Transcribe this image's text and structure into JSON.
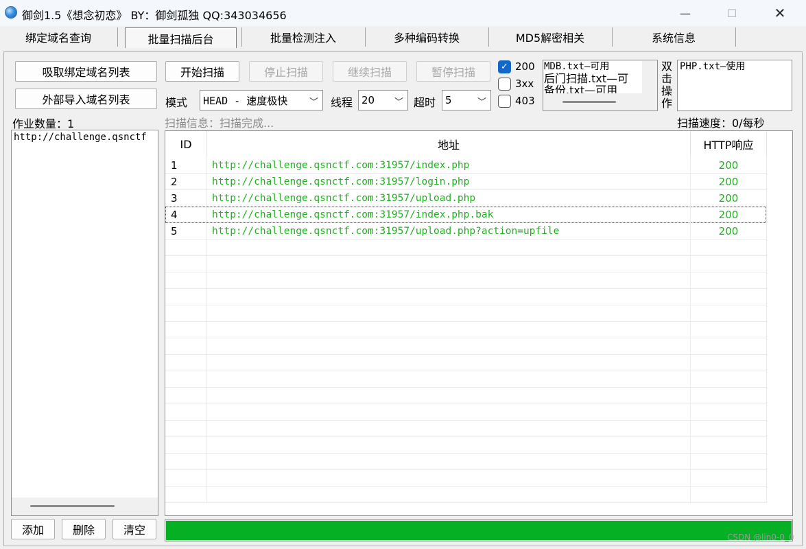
{
  "window": {
    "title": "御剑1.5《想念初恋》 BY：御剑孤独 QQ:343034656",
    "minimize": "—",
    "maximize": "☐",
    "close": "✕"
  },
  "tabs": [
    {
      "label": "绑定域名查询"
    },
    {
      "label": "批量扫描后台"
    },
    {
      "label": "批量检测注入"
    },
    {
      "label": "多种编码转换"
    },
    {
      "label": "MD5解密相关"
    },
    {
      "label": "系统信息"
    }
  ],
  "left": {
    "fetch_button": "吸取绑定域名列表",
    "import_button": "外部导入域名列表",
    "job_count_label": "作业数量：1",
    "domains": [
      "http://challenge.qsnctf"
    ],
    "add_button": "添加",
    "delete_button": "删除",
    "clear_button": "清空"
  },
  "toolbar": {
    "start": "开始扫描",
    "stop": "停止扫描",
    "resume": "继续扫描",
    "pause": "暂停扫描",
    "mode_label": "模式",
    "mode_value": "HEAD - 速度极快",
    "threads_label": "线程",
    "threads_value": "20",
    "timeout_label": "超时",
    "timeout_value": "5",
    "scan_info": "扫描信息：扫描完成...",
    "scan_speed": "扫描速度：0/每秒"
  },
  "status_filters": [
    {
      "label": "200",
      "checked": true
    },
    {
      "label": "3xx",
      "checked": false
    },
    {
      "label": "403",
      "checked": false
    }
  ],
  "dictionaries": {
    "lines": [
      "MDB.txt—可用",
      "后门扫描.txt—可",
      "备份.txt—可用"
    ],
    "double_click_label": [
      "双",
      "击",
      "操",
      "作"
    ],
    "php_list": [
      "PHP.txt—使用"
    ]
  },
  "results": {
    "columns": [
      "ID",
      "地址",
      "HTTP响应"
    ],
    "rows": [
      {
        "id": "1",
        "url": "http://challenge.qsnctf.com:31957/index.php",
        "code": "200"
      },
      {
        "id": "2",
        "url": "http://challenge.qsnctf.com:31957/login.php",
        "code": "200"
      },
      {
        "id": "3",
        "url": "http://challenge.qsnctf.com:31957/upload.php",
        "code": "200"
      },
      {
        "id": "4",
        "url": "http://challenge.qsnctf.com:31957/index.php.bak",
        "code": "200"
      },
      {
        "id": "5",
        "url": "http://challenge.qsnctf.com:31957/upload.php?action=upfile",
        "code": "200"
      }
    ],
    "empty_rows": 16
  },
  "progress": {
    "fraction": 1.0
  },
  "watermark": "CSDN @lin0-0_0",
  "colors": {
    "accent": "#1267c8",
    "success_text": "#22b022",
    "progress": "#06b025"
  }
}
